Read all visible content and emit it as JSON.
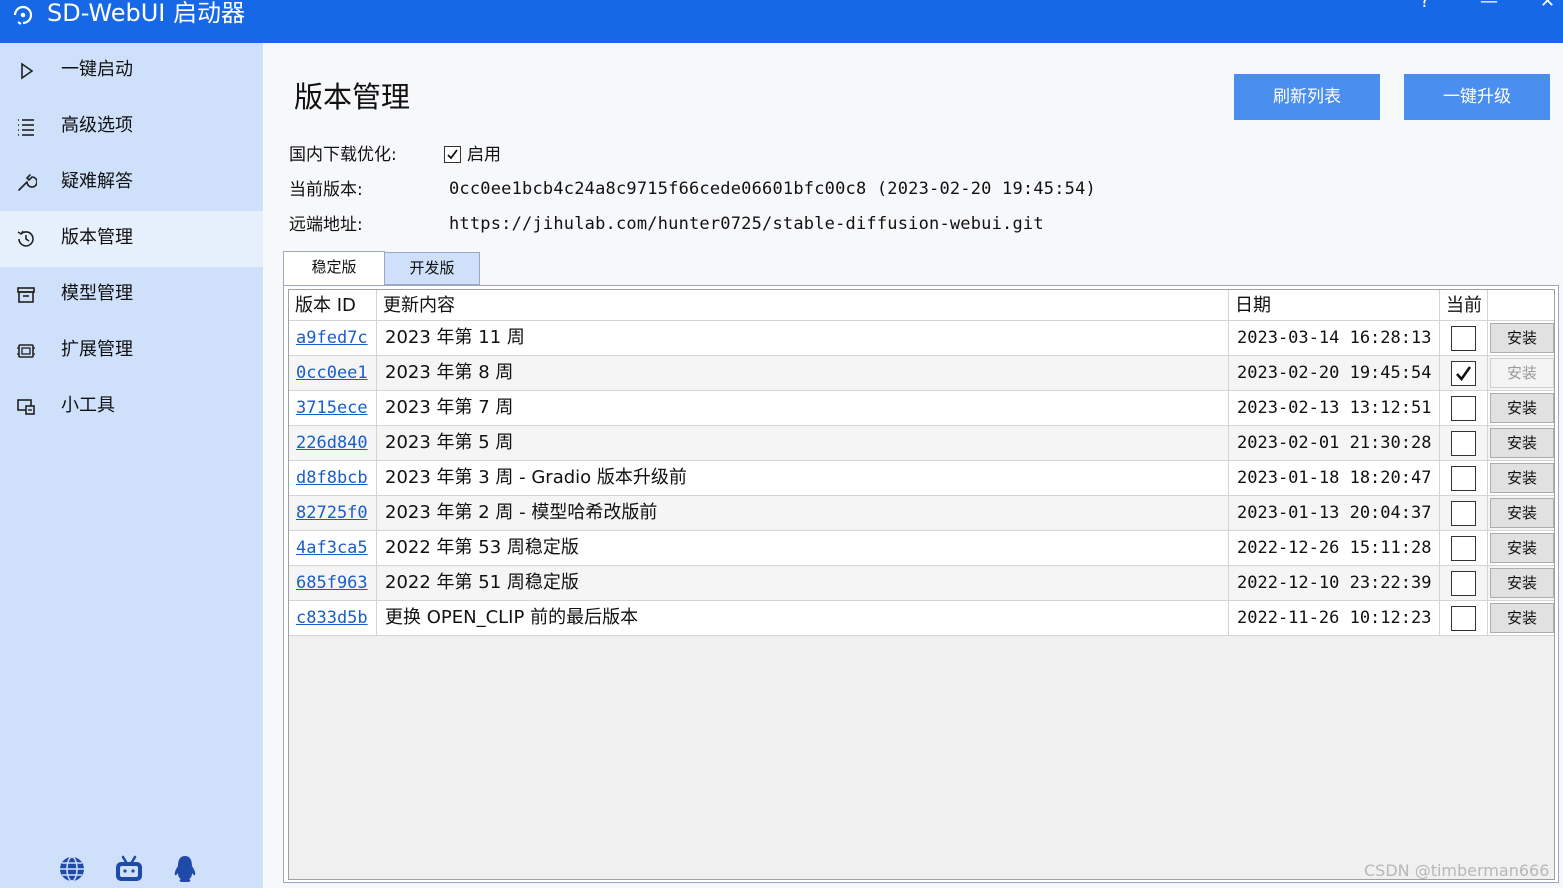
{
  "window": {
    "title": "SD-WebUI 启动器",
    "controls": [
      "?",
      "—",
      "✕"
    ]
  },
  "sidebar": {
    "items": [
      {
        "label": "一键启动",
        "icon": "play-icon",
        "active": false
      },
      {
        "label": "高级选项",
        "icon": "list-icon",
        "active": false
      },
      {
        "label": "疑难解答",
        "icon": "wrench-icon",
        "active": false
      },
      {
        "label": "版本管理",
        "icon": "history-icon",
        "active": true
      },
      {
        "label": "模型管理",
        "icon": "archive-icon",
        "active": false
      },
      {
        "label": "扩展管理",
        "icon": "chip-icon",
        "active": false
      },
      {
        "label": "小工具",
        "icon": "tools-icon",
        "active": false
      }
    ],
    "bottom_icons": [
      "globe-icon",
      "bilibili-icon",
      "qq-icon"
    ]
  },
  "main": {
    "title": "版本管理",
    "refresh_button": "刷新列表",
    "upgrade_button": "一键升级",
    "info": {
      "download_opt_label": "国内下载优化:",
      "download_opt_checkbox": "启用",
      "download_opt_checked": true,
      "current_version_label": "当前版本:",
      "current_version_value": "0cc0ee1bcb4c24a8c9715f66cede06601bfc00c8 (2023-02-20 19:45:54)",
      "remote_label": "远端地址:",
      "remote_value": "https://jihulab.com/hunter0725/stable-diffusion-webui.git"
    },
    "tabs": [
      {
        "label": "稳定版",
        "active": true
      },
      {
        "label": "开发版",
        "active": false
      }
    ],
    "table": {
      "headers": {
        "id": "版本 ID",
        "desc": "更新内容",
        "date": "日期",
        "current": "当前",
        "action": ""
      },
      "rows": [
        {
          "id": "a9fed7c",
          "desc": "2023 年第 11 周",
          "date": "2023-03-14 16:28:13",
          "current": false,
          "action": "安装"
        },
        {
          "id": "0cc0ee1",
          "desc": "2023 年第 8 周",
          "date": "2023-02-20 19:45:54",
          "current": true,
          "action": "安装"
        },
        {
          "id": "3715ece",
          "desc": "2023 年第 7 周",
          "date": "2023-02-13 13:12:51",
          "current": false,
          "action": "安装"
        },
        {
          "id": "226d840",
          "desc": "2023 年第 5 周",
          "date": "2023-02-01 21:30:28",
          "current": false,
          "action": "安装"
        },
        {
          "id": "d8f8bcb",
          "desc": "2023 年第 3 周 - Gradio 版本升级前",
          "date": "2023-01-18 18:20:47",
          "current": false,
          "action": "安装"
        },
        {
          "id": "82725f0",
          "desc": "2023 年第 2 周 - 模型哈希改版前",
          "date": "2023-01-13 20:04:37",
          "current": false,
          "action": "安装"
        },
        {
          "id": "4af3ca5",
          "desc": "2022 年第 53 周稳定版",
          "date": "2022-12-26 15:11:28",
          "current": false,
          "action": "安装"
        },
        {
          "id": "685f963",
          "desc": "2022 年第 51 周稳定版",
          "date": "2022-12-10 23:22:39",
          "current": false,
          "action": "安装"
        },
        {
          "id": "c833d5b",
          "desc": "更换 OPEN_CLIP 前的最后版本",
          "date": "2022-11-26 10:12:23",
          "current": false,
          "action": "安装"
        }
      ]
    }
  },
  "watermark": "CSDN @timberman666",
  "colors": {
    "titlebar": "#1768e6",
    "sidebar": "#cfe0fb",
    "primary_button": "#4a8ef0",
    "link": "#1a5ec9"
  }
}
